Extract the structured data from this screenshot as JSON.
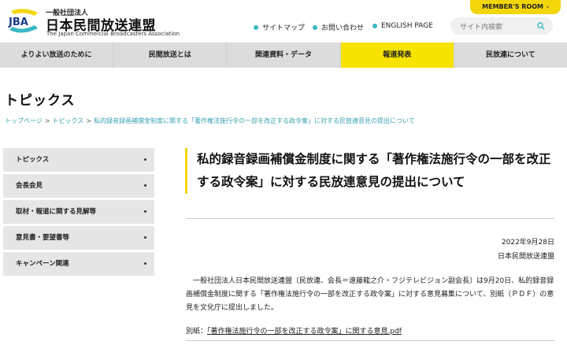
{
  "header": {
    "logo_abbr": "JBA",
    "logo_sub": "一般社団法人",
    "logo_main": "日本民間放送連盟",
    "logo_en": "The Japan Commercial Broadcasters Association",
    "member_button": "MEMBER'S ROOM",
    "links": [
      "サイトマップ",
      "お問い合わせ",
      "ENGLISH PAGE"
    ],
    "search_placeholder": "サイト内検索"
  },
  "nav": {
    "items": [
      "よりよい放送のために",
      "民間放送とは",
      "関連資料・データ",
      "報道発表",
      "民放連について"
    ],
    "active_index": 3
  },
  "page": {
    "title": "トピックス",
    "breadcrumb": [
      "トップページ",
      "トピックス",
      "私的録音録画補償金制度に関する「著作権法施行令の一部を改正する政令案」に対する民放連意見の提出について"
    ]
  },
  "sidebar": {
    "items": [
      "トピックス",
      "会長会見",
      "取材・報道に関する見解等",
      "意見書・要望書等",
      "キャンペーン関連"
    ]
  },
  "article": {
    "title": "私的録音録画補償金制度に関する「著作権法施行令の一部を改正する政令案」に対する民放連意見の提出について",
    "date": "2022年9月28日",
    "org": "日本民間放送連盟",
    "body": "一般社団法人日本民間放送連盟〔民放連、会長＝遠藤龍之介・フジテレビジョン副会長〕は9月20日、私的録音録画補償金制度に関する「著作権法施行令の一部を改正する政令案」に対する意見募集について、別紙（ＰＤＦ）の意見を文化庁に提出しました。",
    "attach_label": "別紙：",
    "attach_link": "「著作権法施行令の一部を改正する政令案」に関する意見.pdf"
  },
  "colors": {
    "accent_yellow": "#f7e300",
    "link_teal": "#3aa3b0",
    "nav_bg": "#dcdcdc",
    "sidebar_bg": "#e6e6e6"
  }
}
